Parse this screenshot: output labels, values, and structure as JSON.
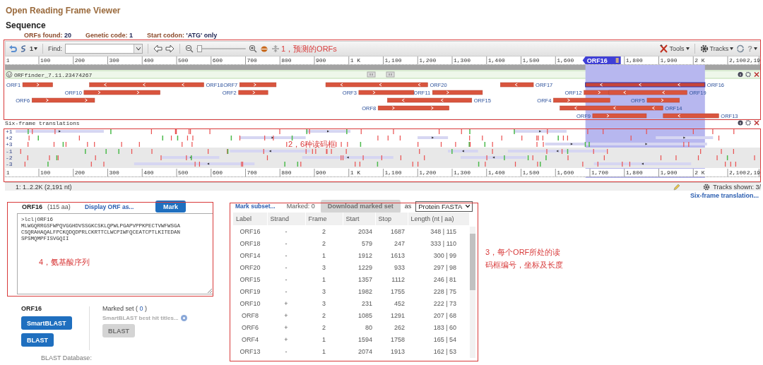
{
  "page_title": "Open Reading Frame Viewer",
  "section_title": "Sequence",
  "summary": [
    {
      "label": "ORFs found:",
      "value": "20"
    },
    {
      "label": "Genetic code:",
      "value": "1"
    },
    {
      "label": "Start codon:",
      "value": "'ATG' only"
    }
  ],
  "viewer": {
    "toolbar": {
      "layout_count": "1",
      "find_label": "Find:",
      "zoom_slider": {
        "level": 0.02
      },
      "tools": "Tools",
      "tracks": "Tracks",
      "help": "?"
    },
    "ruler_top": [
      {
        "label": "1"
      },
      {
        "label": "100"
      },
      {
        "label": "200"
      },
      {
        "label": "300"
      },
      {
        "label": "400"
      },
      {
        "label": "500"
      },
      {
        "label": "600"
      },
      {
        "label": "700"
      },
      {
        "label": "800"
      },
      {
        "label": "900"
      },
      {
        "label": "1 K"
      },
      {
        "label": "1,100"
      },
      {
        "label": "1,200"
      },
      {
        "label": "1,300"
      },
      {
        "label": "1,400"
      },
      {
        "label": "1,500"
      },
      {
        "label": "1,600"
      },
      {
        "label": "1,800"
      },
      {
        "label": "1,900"
      },
      {
        "label": "2 K"
      },
      {
        "label": "2,100"
      },
      {
        "label": "2,19"
      }
    ],
    "selection_marker": "ORF16",
    "orf_track": {
      "title": "ORFfinder_7.11.23474267",
      "lanes": [
        {
          "orfs": [
            {
              "label": "ORF1",
              "reverse": false,
              "selected": false
            },
            {
              "label": "ORF18",
              "reverse": true,
              "selected": false
            },
            {
              "label": "ORF7",
              "reverse": false,
              "selected": false
            },
            {
              "label": "ORF20",
              "reverse": true,
              "selected": false
            },
            {
              "label": "ORF17",
              "reverse": true,
              "selected": false
            },
            {
              "label": "ORF16",
              "reverse": true,
              "selected": true
            }
          ]
        },
        {
          "orfs": [
            {
              "label": "ORF10",
              "reverse": false,
              "selected": false
            },
            {
              "label": "ORF2",
              "reverse": false,
              "selected": false
            },
            {
              "label": "ORF3",
              "reverse": false,
              "selected": false
            },
            {
              "label": "ORF11",
              "reverse": false,
              "selected": false
            },
            {
              "label": "ORF12",
              "reverse": false,
              "selected": false
            },
            {
              "label": "ORF19",
              "reverse": true,
              "selected": false
            }
          ]
        },
        {
          "orfs": [
            {
              "label": "ORF6",
              "reverse": false,
              "selected": false
            },
            {
              "label": "ORF15",
              "reverse": true,
              "selected": false
            },
            {
              "label": "ORF4",
              "reverse": false,
              "selected": false
            },
            {
              "label": "ORF5",
              "reverse": false,
              "selected": false
            }
          ]
        },
        {
          "orfs": [
            {
              "label": "ORF8",
              "reverse": false,
              "selected": false
            },
            {
              "label": "ORF14",
              "reverse": true,
              "selected": false
            }
          ]
        },
        {
          "orfs": [
            {
              "label": "ORF9",
              "reverse": false,
              "selected": false
            },
            {
              "label": "ORF13",
              "reverse": true,
              "selected": false
            }
          ]
        }
      ]
    },
    "six_frame": {
      "title": "Six-frame translations",
      "frames": [
        "+1",
        "+2",
        "+3",
        "-1",
        "-2",
        "-3"
      ]
    },
    "ruler_bottom": [
      {
        "label": "1"
      },
      {
        "label": "100"
      },
      {
        "label": "200"
      },
      {
        "label": "300"
      },
      {
        "label": "400"
      },
      {
        "label": "500"
      },
      {
        "label": "600"
      },
      {
        "label": "700"
      },
      {
        "label": "800"
      },
      {
        "label": "900"
      },
      {
        "label": "1 K"
      },
      {
        "label": "1,100"
      },
      {
        "label": "1,200"
      },
      {
        "label": "1,300"
      },
      {
        "label": "1,400"
      },
      {
        "label": "1,500"
      },
      {
        "label": "1,600"
      },
      {
        "label": "1,700"
      },
      {
        "label": "1,800"
      },
      {
        "label": "1,900"
      },
      {
        "label": "2 K"
      },
      {
        "label": "2,100"
      },
      {
        "label": "2,19"
      }
    ],
    "status": {
      "range": "1: 1..2.2K (2,191 nt)",
      "tracks_shown": "Tracks shown: 3/"
    },
    "link": "Six-frame translation..."
  },
  "detail": {
    "name": "ORF16",
    "length": "(115 aa)",
    "display_link": "Display ORF as...",
    "mark_button": "Mark",
    "fasta": [
      ">lcl|ORF16",
      "MLWGQRRGSFWPQVGGHDVSSGKCSKLQPWLPGAPVPPKPECTVWFWSGA",
      "CSQRAHAQALFPCKQDQDPRLCKRTTCLWCPIWFQCEATCPTLKITEDAN",
      "SPSMQMPFISVGQII"
    ]
  },
  "blast": {
    "orf": "ORF16",
    "smartblast": {
      "label": "SmartBLAST",
      "disabled": false
    },
    "blast": {
      "label": "BLAST",
      "disabled": false
    },
    "marked_set": [
      "Marked set ( ",
      "0",
      " )"
    ],
    "hit_titles": "SmartBLAST best hit titles...",
    "marked_blast": {
      "label": "BLAST",
      "disabled": true
    },
    "database_label": "BLAST Database:"
  },
  "table": {
    "mark_subset": "Mark subset...",
    "marked": "Marked: 0",
    "download": {
      "label": "Download marked set",
      "disabled": true
    },
    "as": "as",
    "format": "Protein FASTA",
    "columns": [
      "Label",
      "Strand",
      "Frame",
      "Start",
      "Stop",
      "Length (nt | aa)"
    ],
    "rows": [
      {
        "cells": [
          "ORF16",
          "-",
          "2",
          "2034",
          "1687",
          "348 | 115"
        ],
        "selected": false
      },
      {
        "cells": [
          "ORF18",
          "-",
          "2",
          "579",
          "247",
          "333 | 110"
        ],
        "selected": false
      },
      {
        "cells": [
          "ORF14",
          "-",
          "1",
          "1912",
          "1613",
          "300 | 99"
        ],
        "selected": false
      },
      {
        "cells": [
          "ORF20",
          "-",
          "3",
          "1229",
          "933",
          "297 | 98"
        ],
        "selected": false
      },
      {
        "cells": [
          "ORF15",
          "-",
          "1",
          "1357",
          "1112",
          "246 | 81"
        ],
        "selected": false
      },
      {
        "cells": [
          "ORF19",
          "-",
          "3",
          "1982",
          "1755",
          "228 | 75"
        ],
        "selected": false
      },
      {
        "cells": [
          "ORF10",
          "+",
          "3",
          "231",
          "452",
          "222 | 73"
        ],
        "selected": false
      },
      {
        "cells": [
          "ORF8",
          "+",
          "2",
          "1085",
          "1291",
          "207 | 68"
        ],
        "selected": false
      },
      {
        "cells": [
          "ORF6",
          "+",
          "2",
          "80",
          "262",
          "183 | 60"
        ],
        "selected": false
      },
      {
        "cells": [
          "ORF4",
          "+",
          "1",
          "1594",
          "1758",
          "165 | 54"
        ],
        "selected": false
      },
      {
        "cells": [
          "ORF13",
          "-",
          "1",
          "2074",
          "1913",
          "162 | 53"
        ],
        "selected": false
      }
    ]
  },
  "annotations": [
    {
      "text": "1，预测的ORFs"
    },
    {
      "text": "2，6种读码框"
    },
    {
      "text": "4，氨基酸序列"
    },
    {
      "text": "3，每个ORF所处的读码框编号，坐标及长度"
    }
  ]
}
